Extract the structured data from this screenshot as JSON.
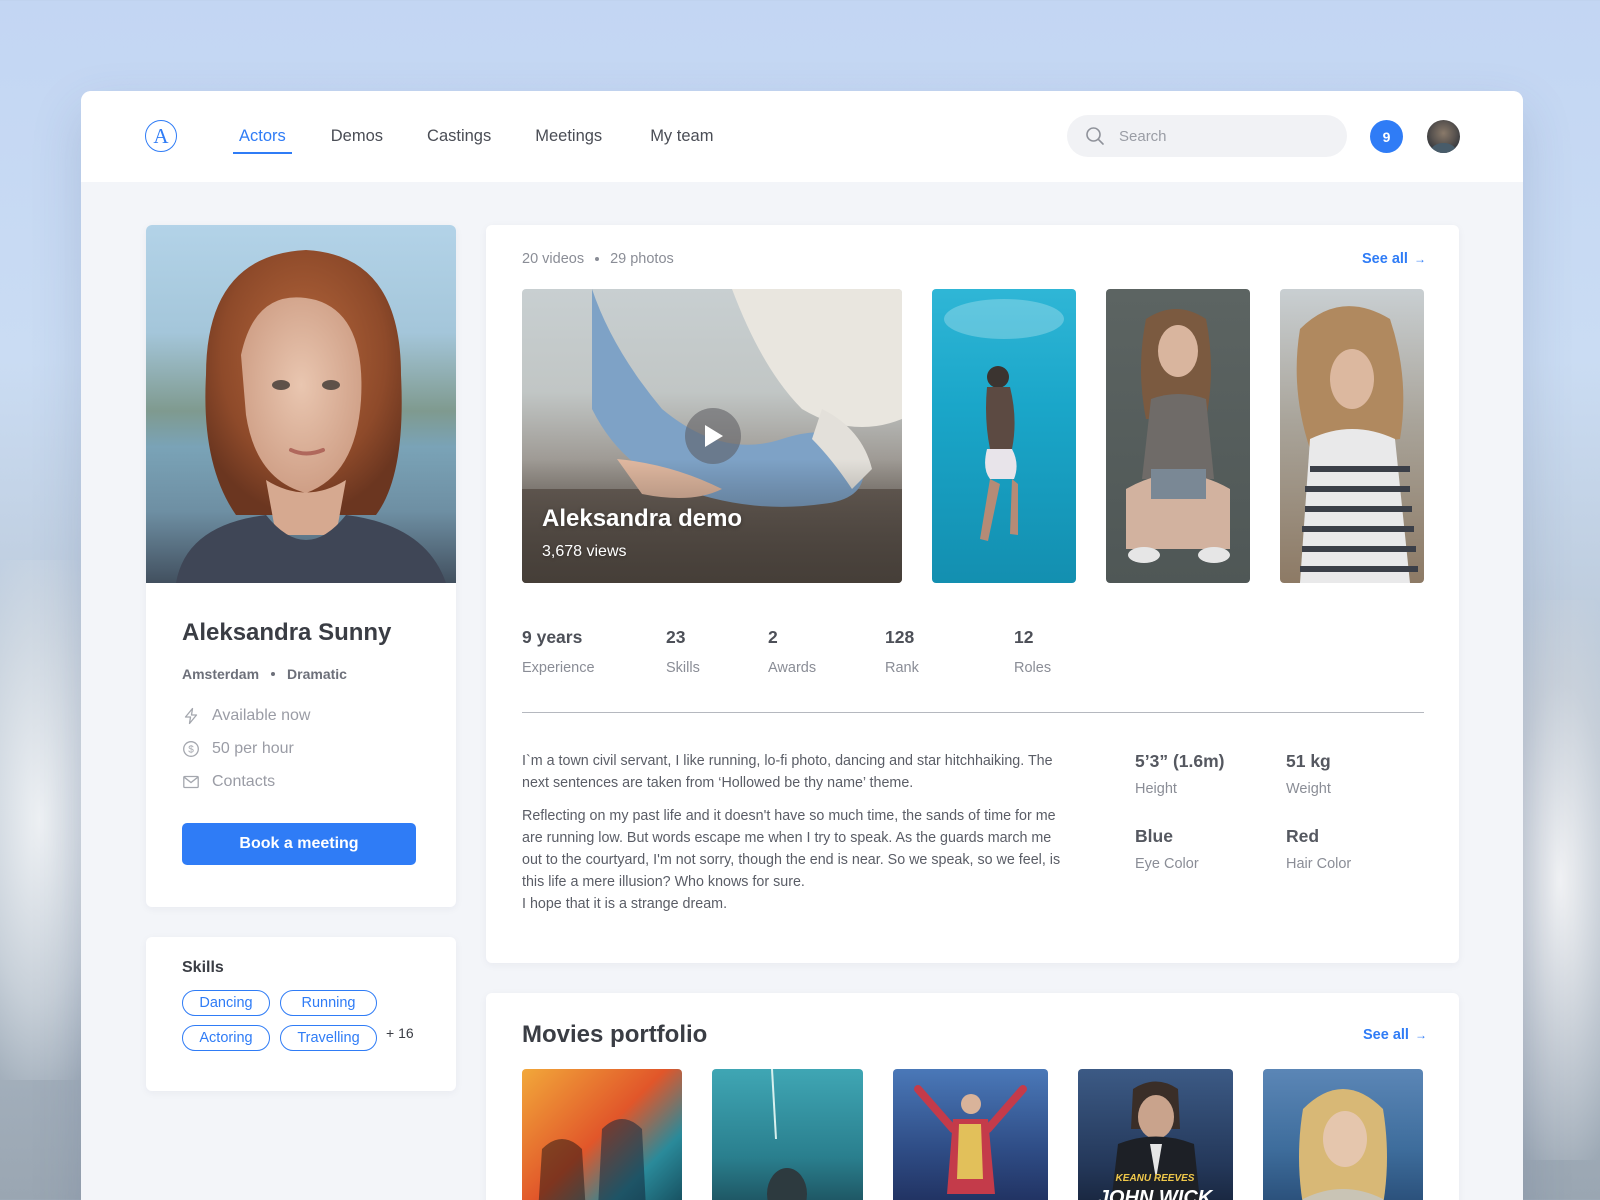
{
  "header": {
    "logo_letter": "A",
    "nav": [
      {
        "label": "Actors",
        "active": true
      },
      {
        "label": "Demos",
        "active": false
      },
      {
        "label": "Castings",
        "active": false
      },
      {
        "label": "Meetings",
        "active": false
      },
      {
        "label": "My team",
        "active": false
      }
    ],
    "search_placeholder": "Search",
    "notification_count": "9",
    "accent_color": "#2f7cf6"
  },
  "profile": {
    "name": "Aleksandra Sunny",
    "city": "Amsterdam",
    "genre": "Dramatic",
    "availability": "Available now",
    "rate": "50 per hour",
    "contacts": "Contacts",
    "book_button": "Book a meeting"
  },
  "skills": {
    "title": "Skills",
    "chips": [
      "Dancing",
      "Running",
      "Actoring",
      "Travelling"
    ],
    "more": "+ 16"
  },
  "media": {
    "videos_count": "20 videos",
    "photos_count": "29 photos",
    "see_all": "See all",
    "video_title": "Aleksandra demo",
    "video_views": "3,678 views"
  },
  "stats": [
    {
      "value": "9 years",
      "label": "Experience"
    },
    {
      "value": "23",
      "label": "Skills"
    },
    {
      "value": "2",
      "label": "Awards"
    },
    {
      "value": "128",
      "label": "Rank"
    },
    {
      "value": "12",
      "label": "Roles"
    }
  ],
  "bio": {
    "paragraph1": "I`m a town civil servant, I like running, lo-fi photo, dancing and star hitchhaiking. The next sentences are taken from ‘Hollowed be thy name’ theme.",
    "paragraph2": "Reflecting on my past life and it doesn't have so much time, the sands of time for me are running low. But words escape me when I try to speak. As the guards march me out to the courtyard, I'm not sorry, though the end is near. So we speak, so we feel, is this life a mere illusion? Who knows for sure.",
    "paragraph3": "I hope that it is a strange dream."
  },
  "attributes": [
    {
      "value": "5’3” (1.6m)",
      "label": "Height"
    },
    {
      "value": "51 kg",
      "label": "Weight"
    },
    {
      "value": "Blue",
      "label": "Eye Color"
    },
    {
      "value": "Red",
      "label": "Hair Color"
    }
  ],
  "movies": {
    "title": "Movies portfolio",
    "see_all": "See all",
    "poster_texts": [
      "KEANU REEVES",
      "JOHN WICK"
    ]
  }
}
